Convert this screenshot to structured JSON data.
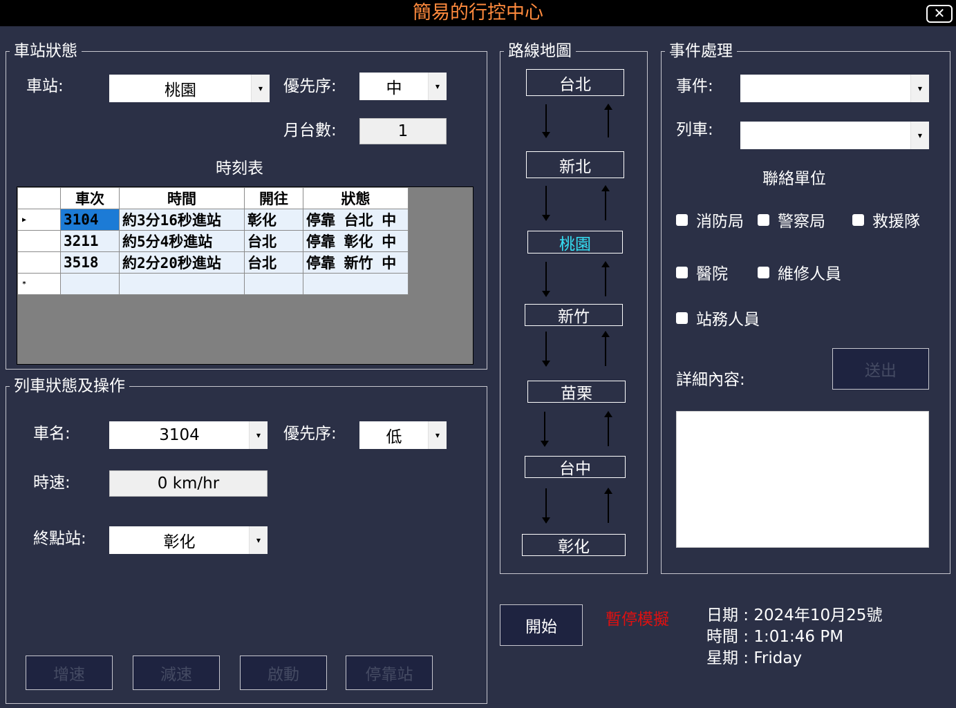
{
  "window": {
    "title": "簡易的行控中心",
    "close_icon": "close-icon"
  },
  "station_status": {
    "group_label": "車站狀態",
    "station_label": "車站:",
    "station_value": "桃園",
    "priority_label": "優先序:",
    "priority_value": "中",
    "platforms_label": "月台數:",
    "platforms_value": "1",
    "timetable_label": "時刻表",
    "timetable": {
      "columns": [
        "車次",
        "時間",
        "開往",
        "狀態"
      ],
      "rows": [
        [
          "3104",
          "約3分16秒進站",
          "彰化",
          "停靠 台北 中"
        ],
        [
          "3211",
          "約5分4秒進站",
          "台北",
          "停靠 彰化 中"
        ],
        [
          "3518",
          "約2分20秒進站",
          "台北",
          "停靠 新竹 中"
        ]
      ]
    }
  },
  "train_status": {
    "group_label": "列車狀態及操作",
    "name_label": "車名:",
    "name_value": "3104",
    "priority_label": "優先序:",
    "priority_value": "低",
    "speed_label": "時速:",
    "speed_value": "0 km/hr",
    "terminal_label": "終點站:",
    "terminal_value": "彰化",
    "buttons": {
      "accelerate": "增速",
      "decelerate": "減速",
      "start": "啟動",
      "stop_at_station": "停靠站"
    }
  },
  "route_map": {
    "group_label": "路線地圖",
    "stations": [
      "台北",
      "新北",
      "桃園",
      "新竹",
      "苗栗",
      "台中",
      "彰化"
    ],
    "current_station": "桃園",
    "current_color": "#35e0f5"
  },
  "incident": {
    "group_label": "事件處理",
    "event_label": "事件:",
    "event_value": "",
    "train_label": "列車:",
    "train_value": "",
    "contacts_label": "聯絡單位",
    "contacts": [
      "消防局",
      "警察局",
      "救援隊",
      "醫院",
      "維修人員",
      "站務人員"
    ],
    "details_label": "詳細內容:",
    "send_label": "送出"
  },
  "simulation": {
    "start_label": "開始",
    "paused_label": "暫停模擬",
    "date_line": "日期 : 2024年10月25號",
    "time_line": "時間 : 1:01:46 PM",
    "weekday_line": "星期 : Friday"
  }
}
